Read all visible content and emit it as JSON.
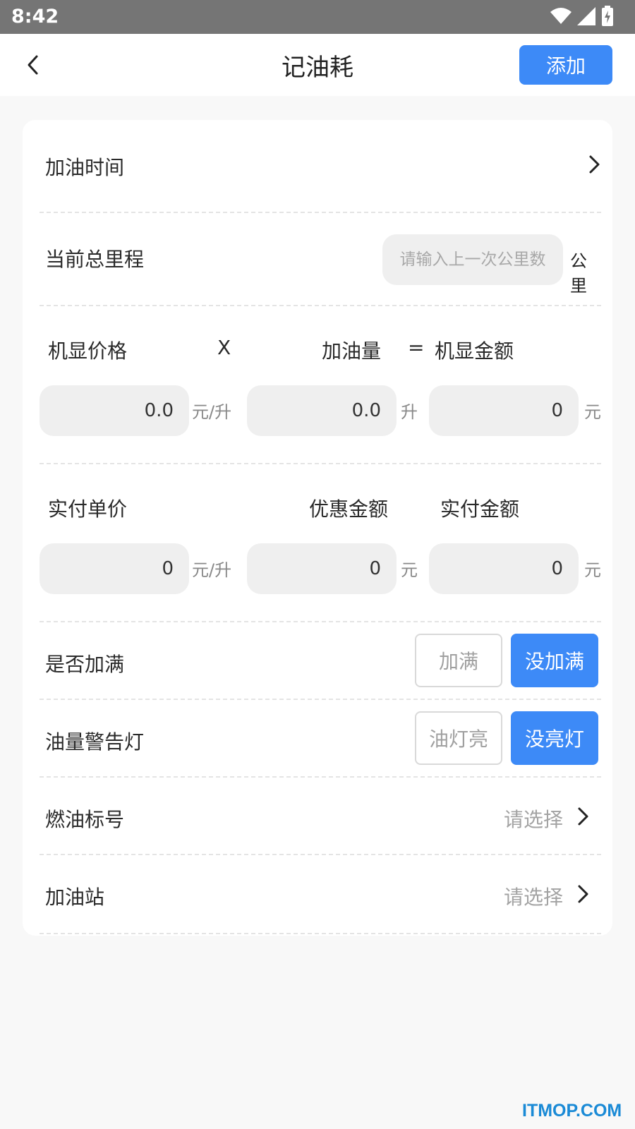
{
  "status_bar": {
    "time": "8:42",
    "icons": [
      "wifi-icon",
      "signal-icon",
      "battery-charging-icon"
    ]
  },
  "header": {
    "title": "记油耗",
    "add_label": "添加"
  },
  "form": {
    "refuel_time": {
      "label": "加油时间"
    },
    "mileage": {
      "label": "当前总里程",
      "placeholder": "请输入上一次公里数",
      "unit": "公里"
    },
    "machine": {
      "price_label": "机显价格",
      "times_sign": "X",
      "volume_label": "加油量",
      "equals_sign": "=",
      "amount_label": "机显金额",
      "price_value": "0.0",
      "price_unit": "元/升",
      "volume_value": "0.0",
      "volume_unit": "升",
      "amount_value": "0",
      "amount_unit": "元"
    },
    "actual": {
      "unit_price_label": "实付单价",
      "discount_label": "优惠金额",
      "paid_label": "实付金额",
      "unit_price_value": "0",
      "unit_price_unit": "元/升",
      "discount_value": "0",
      "discount_unit": "元",
      "paid_value": "0",
      "paid_unit": "元"
    },
    "full_tank": {
      "label": "是否加满",
      "option_full": "加满",
      "option_not_full": "没加满",
      "selected": "没加满"
    },
    "warning_light": {
      "label": "油量警告灯",
      "option_on": "油灯亮",
      "option_off": "没亮灯",
      "selected": "没亮灯"
    },
    "fuel_grade": {
      "label": "燃油标号",
      "value": "请选择"
    },
    "gas_station": {
      "label": "加油站",
      "value": "请选择"
    }
  },
  "watermark": "ITMOP.COM",
  "colors": {
    "accent": "#3d8af7",
    "status_bar": "#757575",
    "watermark": "#1a8ad6"
  }
}
